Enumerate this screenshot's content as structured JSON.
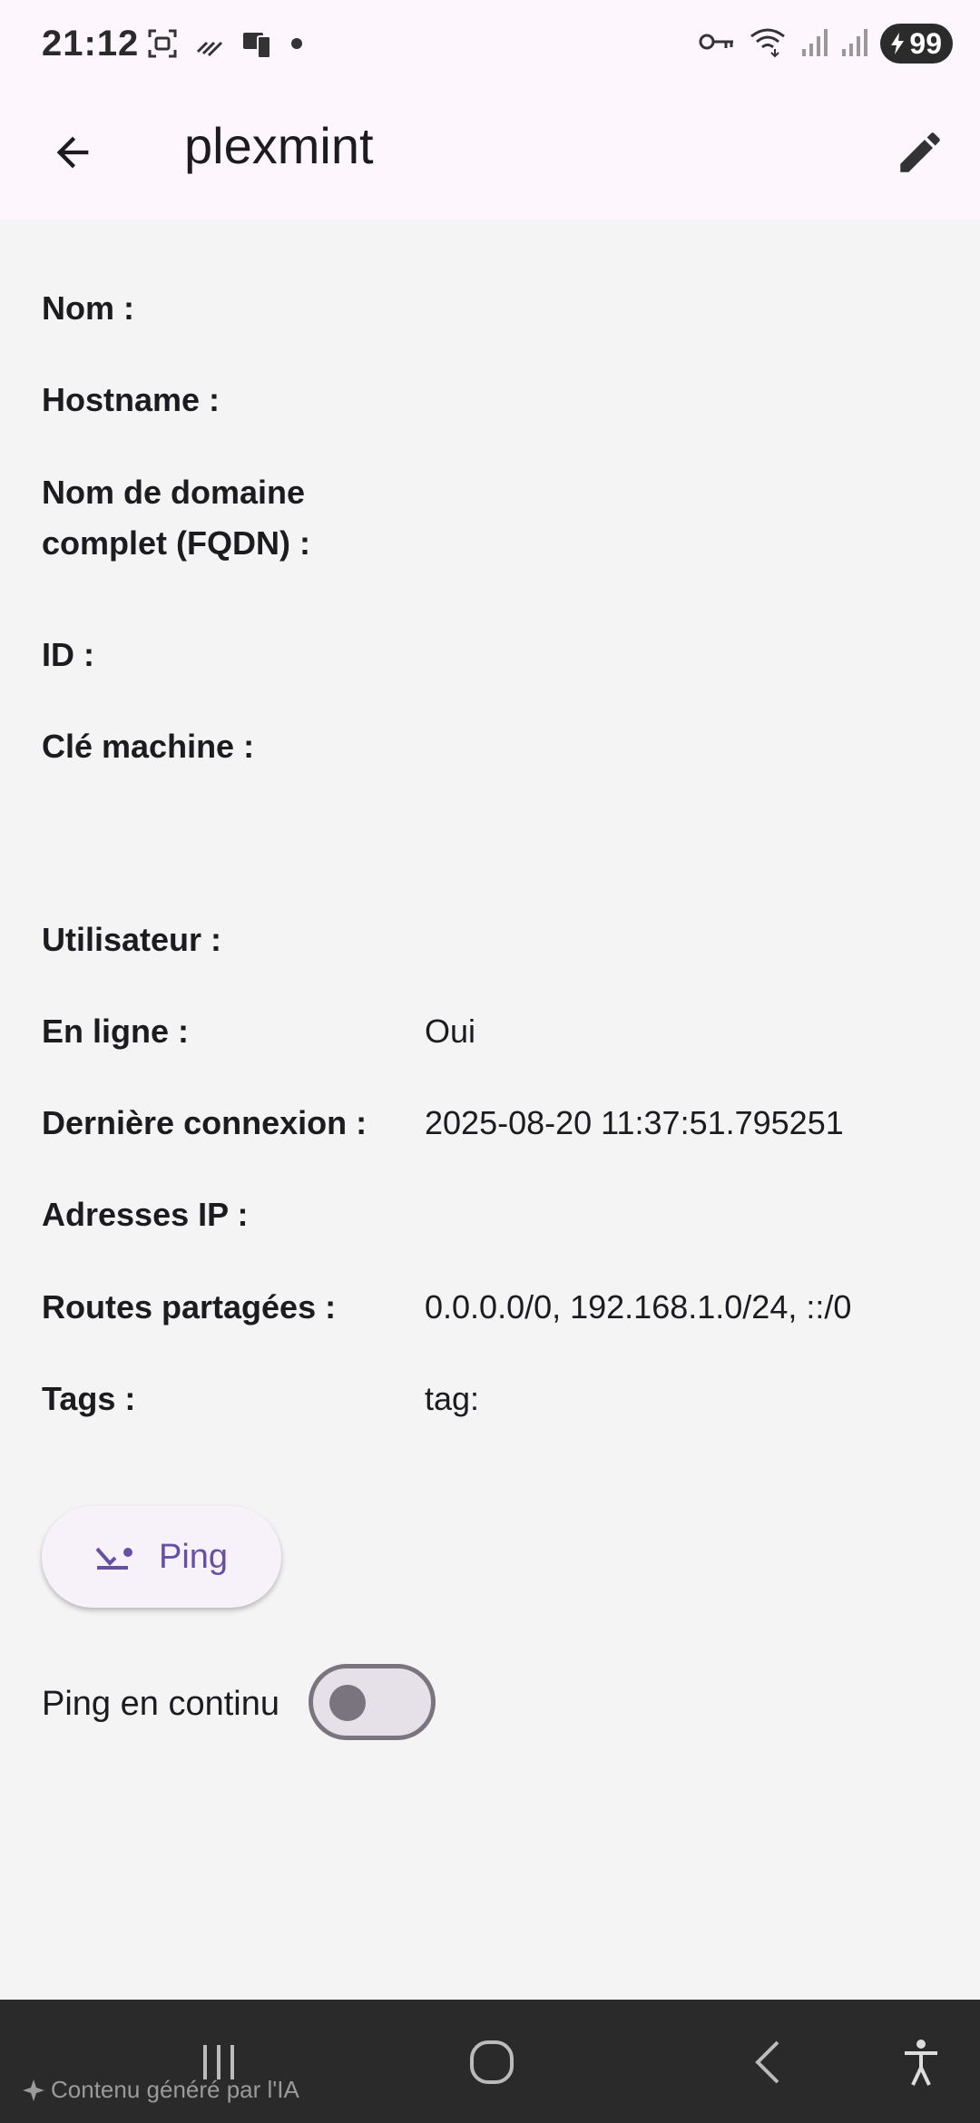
{
  "status_bar": {
    "time": "21:12",
    "battery": "99",
    "icons_left": [
      "screenshot-icon",
      "cast-icon",
      "device-icon",
      "dot-icon"
    ],
    "icons_right": [
      "vpn-key-icon",
      "wifi-icon",
      "signal-icon",
      "signal-icon"
    ]
  },
  "app_bar": {
    "title": "plexmint",
    "back_icon": "arrow-back-icon",
    "edit_icon": "edit-pencil-icon"
  },
  "details": [
    {
      "label": "Nom :",
      "value": ""
    },
    {
      "label": "Hostname :",
      "value": ""
    },
    {
      "label": "Nom de domaine complet (FQDN) :",
      "value": ""
    },
    {
      "label": "ID :",
      "value": ""
    },
    {
      "label": "Clé machine :",
      "value": ""
    },
    {
      "label": "Utilisateur :",
      "value": ""
    },
    {
      "label": "En ligne :",
      "value": "Oui"
    },
    {
      "label": "Dernière connexion :",
      "value": "2025-08-20 11:37:51.795251"
    },
    {
      "label": "Adresses IP :",
      "value": ""
    },
    {
      "label": "Routes partagées :",
      "value": "0.0.0.0/0, 192.168.1.0/24, ::/0"
    },
    {
      "label": "Tags :",
      "value": "tag:"
    }
  ],
  "ping_button": {
    "label": "Ping",
    "icon": "ping-icon"
  },
  "continuous_ping": {
    "label": "Ping en continu",
    "enabled": false
  },
  "nav_bar": {
    "ai_note": "Contenu généré par l'IA",
    "buttons": [
      "recents-icon",
      "home-icon",
      "back-icon",
      "accessibility-icon"
    ]
  },
  "colors": {
    "accent": "#6750a4",
    "app_bar_bg": "#fdf6fc",
    "content_bg": "#f4f4f4",
    "nav_bg": "#2a2a2a"
  }
}
